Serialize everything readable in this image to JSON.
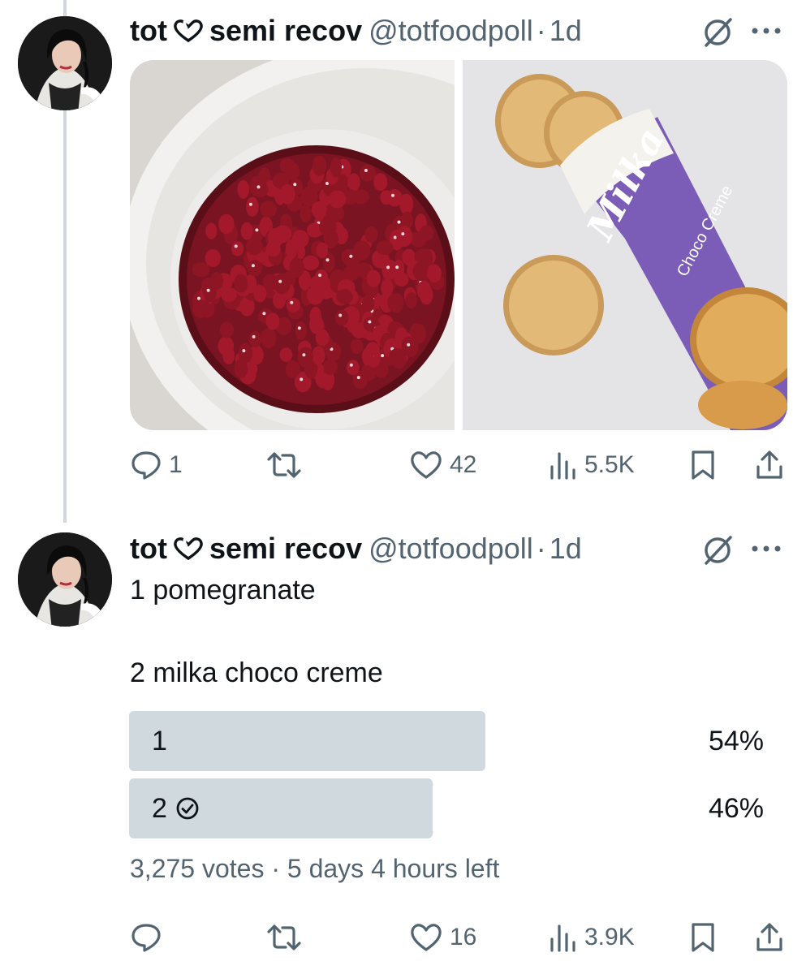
{
  "posts": [
    {
      "author_name": "tot",
      "author_name_suffix": "semi recov",
      "handle": "@totfoodpoll",
      "separator": "·",
      "time": "1d",
      "media": [
        {
          "icon": "pomegranate-seeds-bowl-photo"
        },
        {
          "icon": "milka-choco-creme-package-photo",
          "brand_text": "Milka",
          "product_text": "Choco Creme"
        }
      ],
      "actions": {
        "reply_count": "1",
        "repost_count": "",
        "like_count": "42",
        "view_count": "5.5K"
      }
    },
    {
      "author_name": "tot",
      "author_name_suffix": "semi recov",
      "handle": "@totfoodpoll",
      "separator": "·",
      "time": "1d",
      "text_line_1": "1 pomegranate",
      "text_line_2": "2 milka choco creme",
      "poll": {
        "options": [
          {
            "label": "1",
            "percent_text": "54%",
            "percent": 54,
            "selected": false
          },
          {
            "label": "2",
            "percent_text": "46%",
            "percent": 46,
            "selected": true
          }
        ],
        "meta": "3,275 votes · 5 days 4 hours left"
      },
      "actions": {
        "reply_count": "",
        "repost_count": "",
        "like_count": "16",
        "view_count": "3.9K"
      }
    }
  ],
  "colors": {
    "text": "#0f1419",
    "secondary": "#536471",
    "poll_bar": "#cfd9de",
    "thread_line": "#cfd9de",
    "milka_purple": "#7b5db8"
  }
}
